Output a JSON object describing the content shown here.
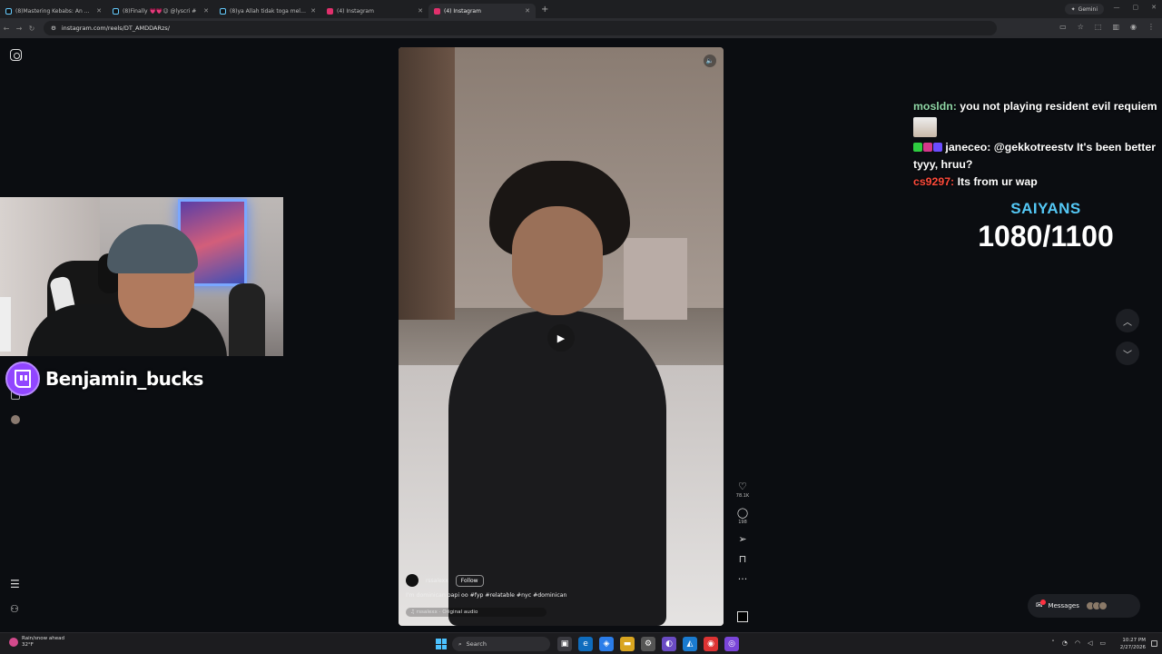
{
  "browser": {
    "tabs": [
      {
        "label": "(8)Mastering Kebabs: An Old M",
        "fav": "tiktok"
      },
      {
        "label": "(8)Finally 💗💗😉 @lyscri #",
        "fav": "tiktok"
      },
      {
        "label": "(8)ya Allah tidak toga melihat",
        "fav": "tiktok"
      },
      {
        "label": "(4) Instagram",
        "fav": "instagram"
      },
      {
        "label": "(4) Instagram",
        "fav": "instagram",
        "active": true
      }
    ],
    "gemini_label": "Gemini",
    "url": "instagram.com/reels/DT_AMDDARzs/"
  },
  "reel": {
    "author": "rssalexx",
    "follow_label": "Follow",
    "caption": "I'm dominican papi oo #fyp #relatable #nyc #dominican",
    "audio": "rssalexx · Original audio",
    "likes": "78.1K",
    "comments": "198"
  },
  "stream": {
    "streamer_name": "Benjamin_bucks",
    "goal_title": "SAIYANS",
    "goal_count": "1080/1100"
  },
  "chat": [
    {
      "user": "mosldn",
      "color": "green",
      "text": "you not playing resident evil requiem"
    },
    {
      "emote": true
    },
    {
      "user": "janeceo",
      "color": "white",
      "badges": true,
      "text": "@gekkotreestv It's been better tyyy, hruu?"
    },
    {
      "user": "cs9297",
      "color": "red",
      "text": "Its from ur wap"
    }
  ],
  "messages_label": "Messages",
  "taskbar": {
    "weather_line1": "Rain/snow ahead",
    "weather_line2": "32°F",
    "search_placeholder": "Search",
    "time": "10:27 PM",
    "date": "2/27/2026"
  },
  "colors": {
    "accent_twitch": "#9146ff",
    "goal_title": "#54c8f5",
    "chat_green": "#8fd6a6",
    "chat_red": "#ff4a3a"
  }
}
